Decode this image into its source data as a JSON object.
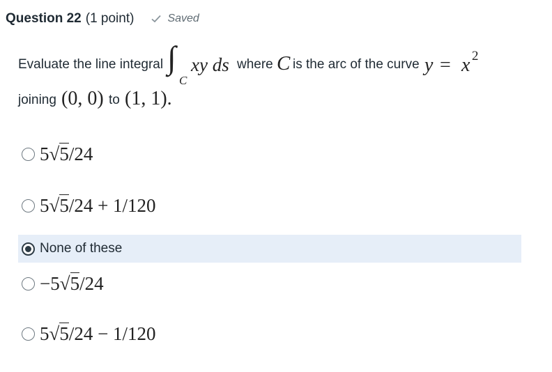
{
  "header": {
    "question_title": "Question 22",
    "points": "(1 point)",
    "saved_label": "Saved"
  },
  "question": {
    "text_before": "Evaluate the line integral",
    "integral_sign": "∫",
    "integral_subscript": "C",
    "integrand": "xy ds",
    "text_where": "where",
    "curve_symbol": "C",
    "text_is_arc": "is the arc of the curve",
    "curve_eq_lhs": "y",
    "curve_eq_op": "=",
    "curve_eq_rhs": "x",
    "curve_eq_exp": "2",
    "text_joining": "joining",
    "point_start": "(0, 0)",
    "text_to": "to",
    "point_end": "(1, 1)."
  },
  "options": [
    {
      "prefix": "5",
      "radicand": "5",
      "suffix": "/24",
      "selected": false
    },
    {
      "prefix": "5",
      "radicand": "5",
      "suffix": "/24 + 1/120",
      "selected": false
    },
    {
      "text": "None of these",
      "selected": true
    },
    {
      "prefix": "−5",
      "radicand": "5",
      "suffix": "/24",
      "selected": false
    },
    {
      "prefix": "5",
      "radicand": "5",
      "suffix": "/24 − 1/120",
      "selected": false
    }
  ]
}
